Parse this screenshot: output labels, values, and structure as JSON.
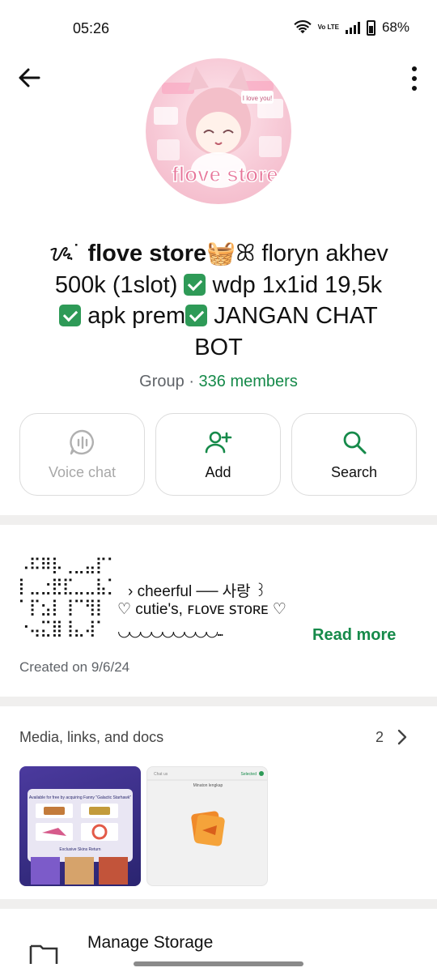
{
  "status_bar": {
    "time": "05:26",
    "network_label": "Vo LTE",
    "battery": "68%"
  },
  "header": {
    "back_icon": "arrow-left-icon",
    "menu_icon": "more-vertical-icon"
  },
  "avatar": {
    "caption": "flove store",
    "badge": "I love you!"
  },
  "group": {
    "name_prefix": "ᝰ˙ ",
    "name_bold": "flove store",
    "name_line1_rest": "🧺ꕤ floryn akhev",
    "name_line2": "500k (1slot) ",
    "name_line2b": " wdp 1x1id 19,5k",
    "name_line3a": " apk prem",
    "name_line3b": " JANGAN CHAT",
    "name_line4": "BOT",
    "type": "Group",
    "separator": " · ",
    "members": "336 members"
  },
  "actions": [
    {
      "label": "Voice chat",
      "icon": "voice-chat-icon",
      "enabled": false
    },
    {
      "label": "Add",
      "icon": "add-person-icon",
      "enabled": true
    },
    {
      "label": "Search",
      "icon": "search-icon",
      "enabled": true
    }
  ],
  "description": {
    "braille_art": "⠠⠯⠿⡧⢀⣀⣤⡏⠁\n⡇⣀⣐⣟⣏⣀⣀⣧⡁\n⠁⡏⣢⡇⢸⠉⢻⡇\n⠐⢤⣍⣿⢸⣄⢼⠁",
    "line1": "› cheerful ── 사랑 ꒱",
    "line2": "♡ cutie's, ꜰʟᴏᴠᴇ ꜱᴛᴏʀᴇ ♡",
    "line3": "◡◡◡◡◡◡◡◡◡...",
    "read_more": "Read more",
    "created": "Created on 9/6/24"
  },
  "media": {
    "title": "Media, links, and docs",
    "count": "2",
    "chevron_icon": "chevron-right-icon",
    "thumb1_caption": "Available for free by acquiring Fanny \"Galactic Starhawk\"",
    "thumb1_footer": "Exclusive Skins Return",
    "thumb2_header_left": "Chat us",
    "thumb2_header_right": "Selected",
    "thumb2_subheader": "Minaton lengkap"
  },
  "storage": {
    "label": "Manage Storage",
    "icon": "storage-icon"
  },
  "colors": {
    "accent": "#168a4a",
    "check_green": "#2e9a57",
    "background": "#f0efee",
    "card": "#ffffff"
  }
}
